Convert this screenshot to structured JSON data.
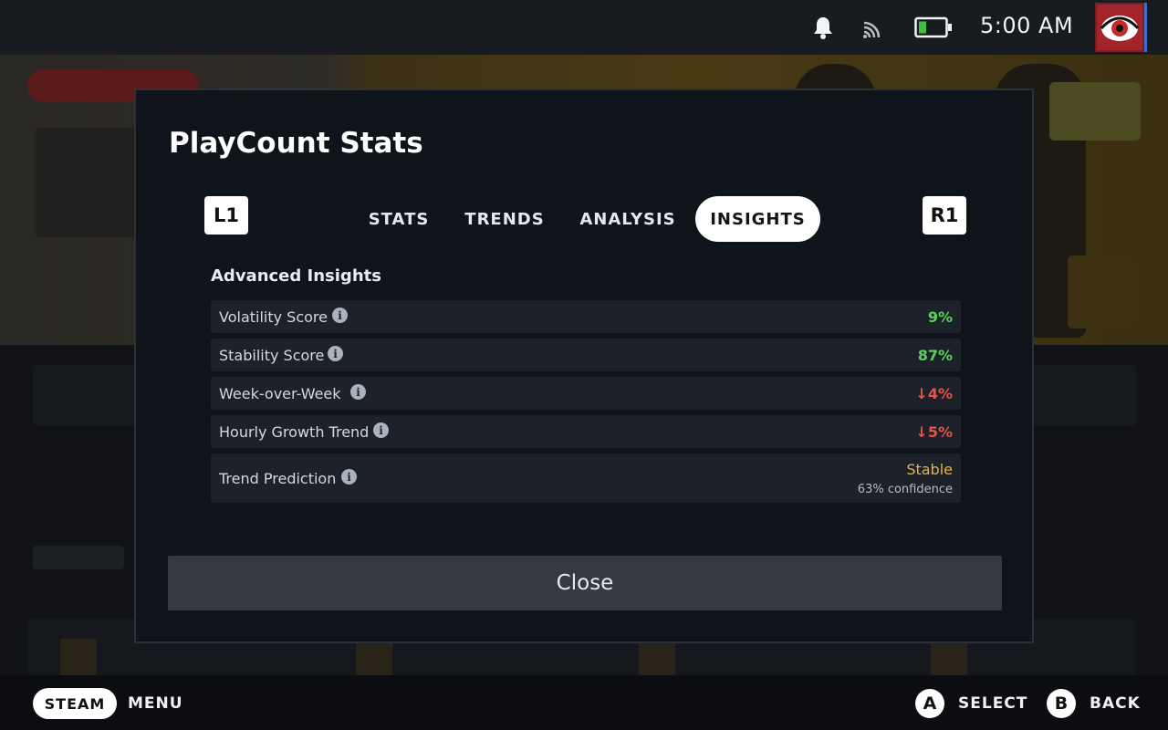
{
  "status_bar": {
    "time": "5:00 AM",
    "icons": [
      "bell-icon",
      "cast-icon",
      "battery-icon",
      "avatar"
    ],
    "battery_color": "#3ec03e"
  },
  "modal": {
    "title": "PlayCount Stats",
    "left_shoulder": "L1",
    "right_shoulder": "R1",
    "tabs": [
      {
        "label": "STATS",
        "active": false
      },
      {
        "label": "TRENDS",
        "active": false
      },
      {
        "label": "ANALYSIS",
        "active": false
      },
      {
        "label": "INSIGHTS",
        "active": true
      }
    ],
    "section_title": "Advanced Insights",
    "rows": [
      {
        "label": "Volatility Score",
        "value": "9%",
        "color": "#59d25a"
      },
      {
        "label": "Stability Score",
        "value": "87%",
        "color": "#59d25a"
      },
      {
        "label": "Week-over-Week",
        "value": "↓4%",
        "color": "#e5534b"
      },
      {
        "label": "Hourly Growth Trend",
        "value": "↓5%",
        "color": "#e5534b"
      },
      {
        "label": "Trend Prediction",
        "value": "Stable",
        "sub": "63% confidence",
        "color": "#e8b13a"
      }
    ],
    "close_label": "Close"
  },
  "bottom_bar": {
    "steam": "STEAM",
    "menu": "MENU",
    "a_button": "A",
    "select": "SELECT",
    "b_button": "B",
    "back": "BACK"
  }
}
